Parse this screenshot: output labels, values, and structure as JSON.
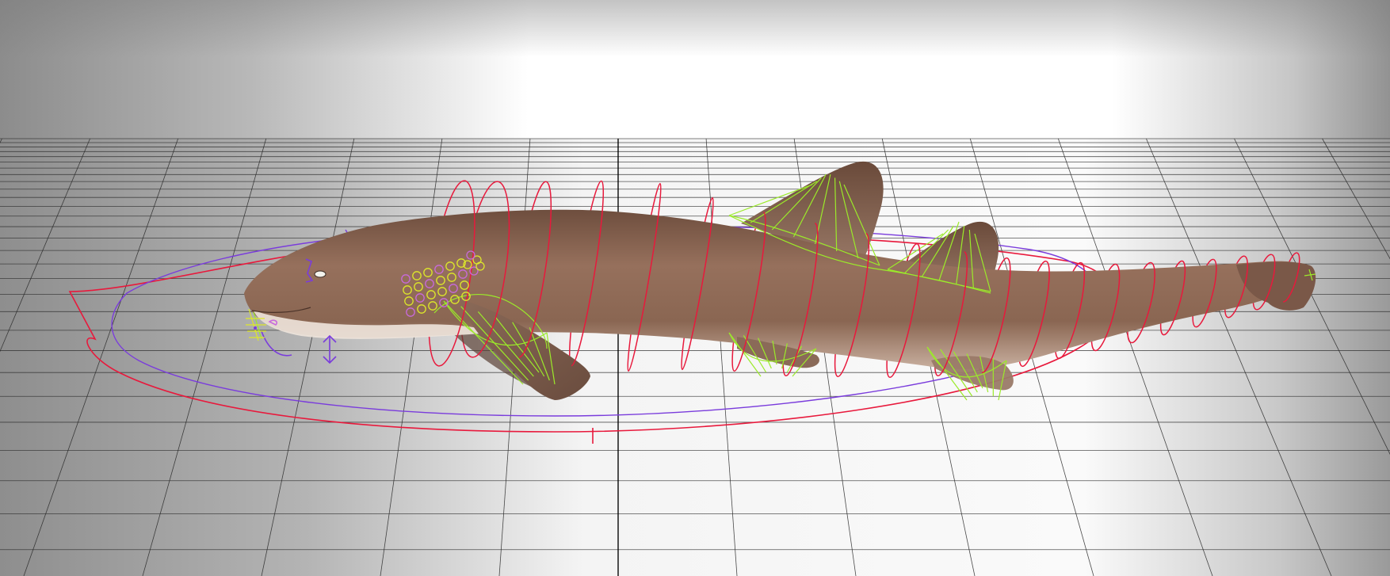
{
  "viewport": {
    "background_gradient": [
      "#8a8a8a",
      "#ffffff",
      "#ffffff",
      "#8a8a8a"
    ],
    "grid_color": "#2a2a2a",
    "grid_axis_color": "#000000",
    "grid_visible": true
  },
  "model": {
    "icon": "shark-model",
    "skin_color": "#8a6652",
    "belly_color": "#e8ddd4",
    "fin_color": "#7a5848"
  },
  "rig_controls": {
    "ring_color": "#e8193c",
    "fin_curve_color": "#9bea2a",
    "face_control_color": "#7a3cdc",
    "gill_dot_colors": [
      "#dde82a",
      "#c86adc"
    ],
    "master_control_colors": [
      "#e8193c",
      "#7a3cdc"
    ]
  }
}
